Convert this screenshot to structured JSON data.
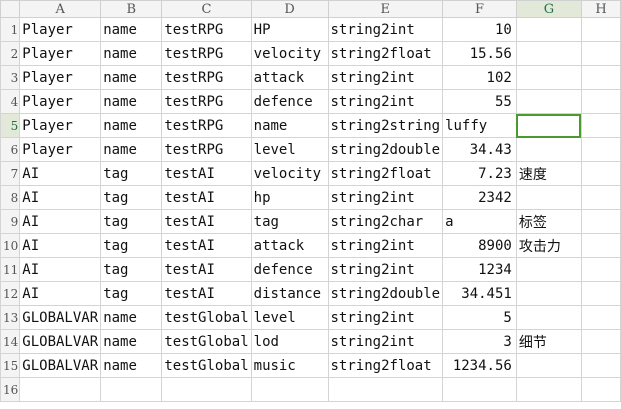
{
  "columns": [
    "A",
    "B",
    "C",
    "D",
    "E",
    "F",
    "G",
    "H"
  ],
  "selected_column": "G",
  "selected_row": 5,
  "rows": [
    {
      "row": "1",
      "cells": [
        "Player",
        "name",
        "testRPG",
        "HP",
        "string2int",
        "10",
        ""
      ]
    },
    {
      "row": "2",
      "cells": [
        "Player",
        "name",
        "testRPG",
        "velocity",
        "string2float",
        "15.56",
        ""
      ]
    },
    {
      "row": "3",
      "cells": [
        "Player",
        "name",
        "testRPG",
        "attack",
        "string2int",
        "102",
        ""
      ]
    },
    {
      "row": "4",
      "cells": [
        "Player",
        "name",
        "testRPG",
        "defence",
        "string2int",
        "55",
        ""
      ]
    },
    {
      "row": "5",
      "cells": [
        "Player",
        "name",
        "testRPG",
        "name",
        "string2string",
        "luffy",
        ""
      ]
    },
    {
      "row": "6",
      "cells": [
        "Player",
        "name",
        "testRPG",
        "level",
        "string2double",
        "34.43",
        ""
      ]
    },
    {
      "row": "7",
      "cells": [
        "AI",
        "tag",
        "testAI",
        "velocity",
        "string2float",
        "7.23",
        "速度"
      ]
    },
    {
      "row": "8",
      "cells": [
        "AI",
        "tag",
        "testAI",
        "hp",
        "string2int",
        "2342",
        ""
      ]
    },
    {
      "row": "9",
      "cells": [
        "AI",
        "tag",
        "testAI",
        "tag",
        "string2char",
        "a",
        "标签"
      ]
    },
    {
      "row": "10",
      "cells": [
        "AI",
        "tag",
        "testAI",
        "attack",
        "string2int",
        "8900",
        "攻击力"
      ]
    },
    {
      "row": "11",
      "cells": [
        "AI",
        "tag",
        "testAI",
        "defence",
        "string2int",
        "1234",
        ""
      ]
    },
    {
      "row": "12",
      "cells": [
        "AI",
        "tag",
        "testAI",
        "distance",
        "string2double",
        "34.451",
        ""
      ]
    },
    {
      "row": "13",
      "cells": [
        "GLOBALVAR",
        "name",
        "testGlobal",
        "level",
        "string2int",
        "5",
        ""
      ]
    },
    {
      "row": "14",
      "cells": [
        "GLOBALVAR",
        "name",
        "testGlobal",
        "lod",
        "string2int",
        "3",
        "细节"
      ]
    },
    {
      "row": "15",
      "cells": [
        "GLOBALVAR",
        "name",
        "testGlobal",
        "music",
        "string2float",
        "1234.56",
        ""
      ]
    },
    {
      "row": "16",
      "cells": [
        "",
        "",
        "",
        "",
        "",
        "",
        ""
      ]
    }
  ],
  "colors": {
    "grid": "#d4d4d4",
    "header_bg": "#f4f4f4",
    "selection": "#4a9a32"
  }
}
